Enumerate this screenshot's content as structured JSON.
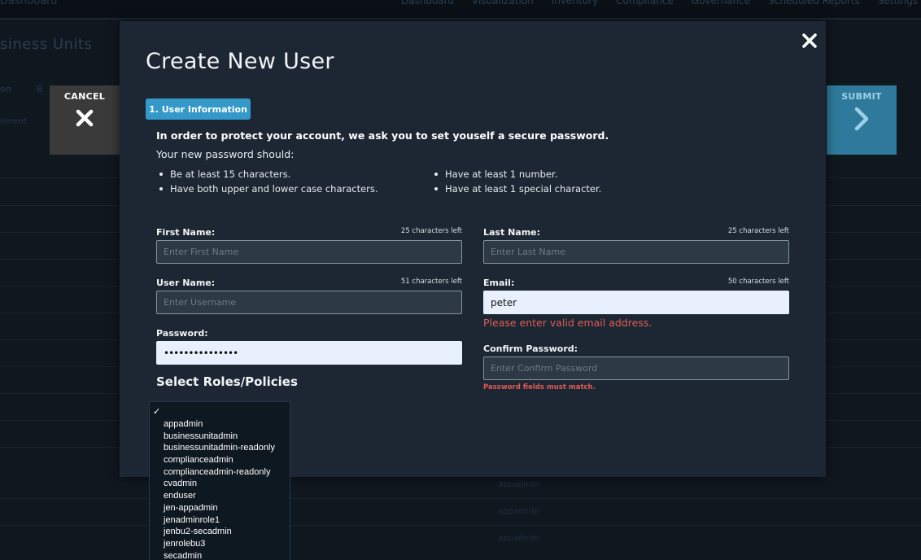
{
  "background": {
    "brand": "Dashboard",
    "nav": [
      "Dashboard",
      "Visualization",
      "Inventory",
      "Compliance",
      "Governance",
      "Scheduled Reports",
      "Settings"
    ],
    "page_title": "siness Units",
    "tab_left": "on",
    "tab_left2": "B",
    "sub_left": "nment",
    "row_cells": [
      "appadmin",
      "appadmin",
      "appadmin"
    ]
  },
  "actions": {
    "cancel_label": "CANCEL",
    "submit_label": "SUBMIT"
  },
  "modal": {
    "title": "Create New User",
    "step_label": "1. User Information",
    "intro": "In order to protect your account, we ask you to set youself a secure password.",
    "sub": "Your new password should:",
    "rules_left": [
      "Be at least 15 characters.",
      "Have both upper and lower case characters."
    ],
    "rules_right": [
      "Have at least 1 number.",
      "Have at least 1 special character."
    ],
    "fields": {
      "first_name": {
        "label": "First Name:",
        "counter": "25 characters left",
        "placeholder": "Enter First Name"
      },
      "last_name": {
        "label": "Last Name:",
        "counter": "25 characters left",
        "placeholder": "Enter Last Name"
      },
      "user_name": {
        "label": "User Name:",
        "counter": "51 characters left",
        "placeholder": "Enter Username"
      },
      "email": {
        "label": "Email:",
        "counter": "50 characters left",
        "value": "peter",
        "error": "Please enter valid email address."
      },
      "password": {
        "label": "Password:",
        "value": "•••••••••••••••"
      },
      "confirm_password": {
        "label": "Confirm Password:",
        "placeholder": "Enter Confirm Password",
        "error": "Password fields must match."
      }
    },
    "roles_title": "Select Roles/Policies"
  },
  "dropdown": {
    "selected_mark": "✓",
    "options": [
      "appadmin",
      "businessunitadmin",
      "businessunitadmin-readonly",
      "complianceadmin",
      "complianceadmin-readonly",
      "cvadmin",
      "enduser",
      "jen-appadmin",
      "jenadminrole1",
      "jenbu2-secadmin",
      "jenrolebu3",
      "secadmin"
    ]
  },
  "colors": {
    "accent": "#3498c9",
    "error": "#e05c54",
    "modal_bg": "#1c2733"
  }
}
